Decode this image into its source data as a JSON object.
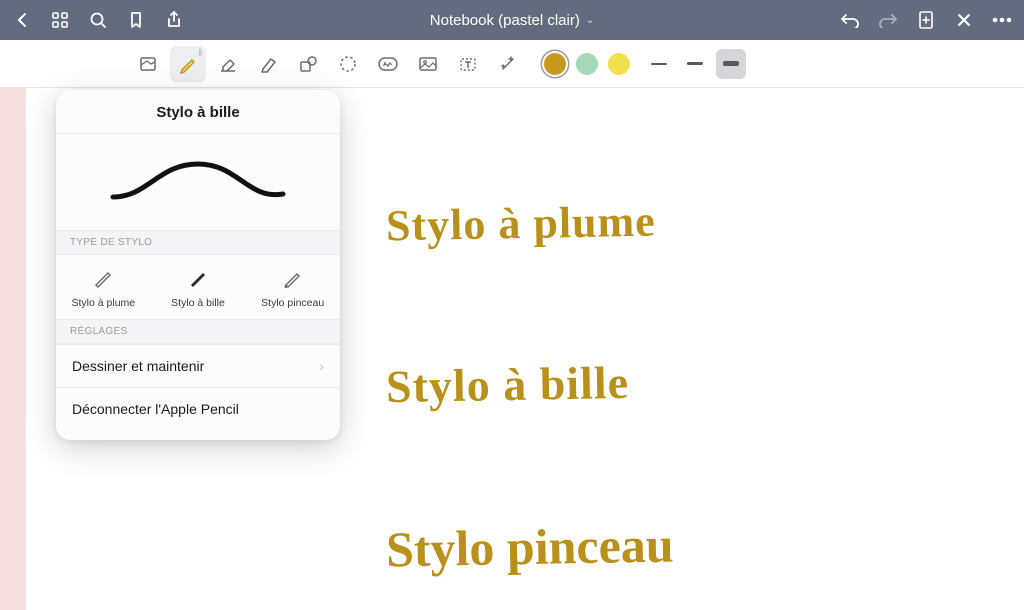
{
  "header": {
    "title": "Notebook (pastel clair)"
  },
  "colors": {
    "accent_gold": "#b8901a",
    "swatch1": "#c6981d",
    "swatch2": "#a7d9b9",
    "swatch3": "#f2e14e"
  },
  "popover": {
    "title": "Stylo à bille",
    "section_type": "TYPE DE STYLO",
    "section_settings": "RÉGLAGES",
    "pen_types": [
      {
        "label": "Stylo à plume"
      },
      {
        "label": "Stylo à bille"
      },
      {
        "label": "Stylo pinceau"
      }
    ],
    "settings": {
      "draw_hold": "Dessiner et maintenir",
      "disconnect": "Déconnecter l'Apple Pencil"
    }
  },
  "canvas": {
    "hw1": "Stylo à plume",
    "hw2": "Stylo à bille",
    "hw3": "Stylo pinceau"
  }
}
